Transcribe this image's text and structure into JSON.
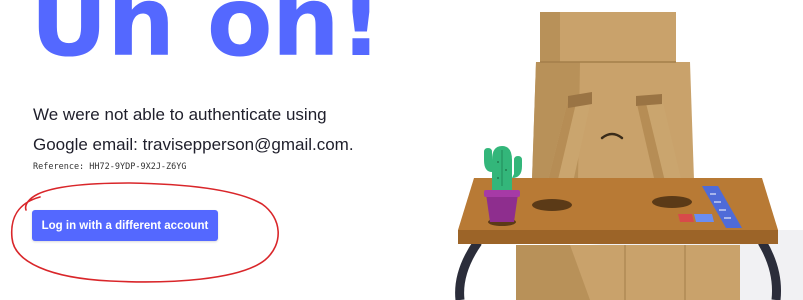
{
  "headline": "Uh oh!",
  "message": {
    "line1": "We were not able to authenticate using",
    "line2": "Google email: travisepperson@gmail.com."
  },
  "reference": "Reference: HH72-9YDP-9X2J-Z6YG",
  "login_button": {
    "label": "Log in with a different account"
  },
  "colors": {
    "accent": "#5468ff",
    "annotation": "#d9262a",
    "cardboard": "#c9a26b",
    "desk": "#b87a35"
  }
}
